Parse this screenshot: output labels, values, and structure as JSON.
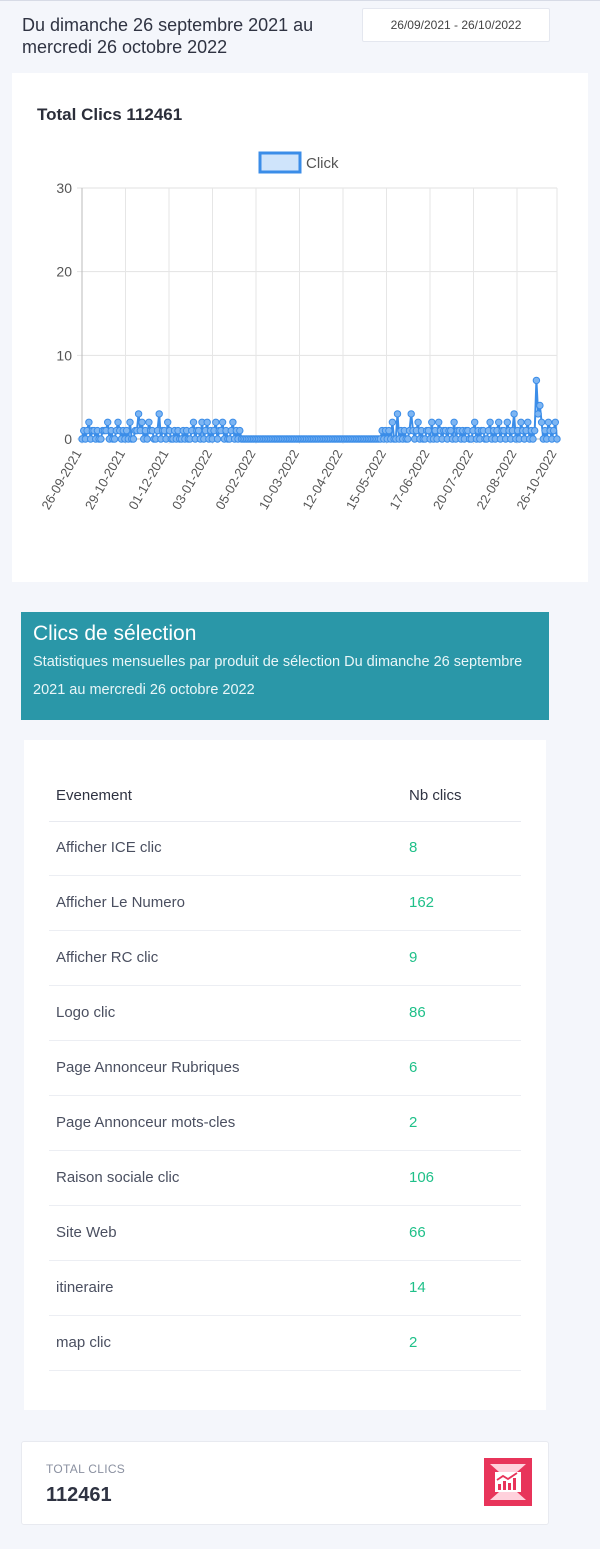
{
  "header": {
    "period_title": "Du dimanche 26 septembre 2021 au mercredi 26 octobre 2022",
    "date_range_value": "26/09/2021 - 26/10/2022"
  },
  "chart_card": {
    "title": "Total Clics 112461"
  },
  "chart_data": {
    "type": "line",
    "legend": [
      "Click"
    ],
    "legend_position": "top",
    "ylim": [
      0,
      30
    ],
    "yticks": [
      0,
      10,
      20,
      30
    ],
    "grid": true,
    "x_tick_labels": [
      "26-09-2021",
      "29-10-2021",
      "01-12-2021",
      "03-01-2022",
      "05-02-2022",
      "10-03-2022",
      "12-04-2022",
      "15-05-2022",
      "17-06-2022",
      "20-07-2022",
      "22-08-2022",
      "26-10-2022"
    ],
    "series": [
      {
        "name": "Click",
        "color": "#3b8de8",
        "values": [
          0,
          1,
          0,
          1,
          2,
          0,
          1,
          1,
          0,
          1,
          0,
          0,
          1,
          1,
          1,
          2,
          0,
          1,
          0,
          0,
          1,
          2,
          1,
          0,
          1,
          0,
          1,
          0,
          2,
          0,
          0,
          1,
          1,
          3,
          1,
          2,
          0,
          1,
          0,
          2,
          1,
          1,
          0,
          0,
          1,
          3,
          0,
          1,
          1,
          0,
          2,
          1,
          0,
          0,
          1,
          0,
          1,
          0,
          0,
          1,
          0,
          1,
          0,
          0,
          1,
          2,
          0,
          1,
          1,
          0,
          2,
          0,
          1,
          2,
          0,
          1,
          0,
          1,
          2,
          0,
          1,
          1,
          2,
          0,
          1,
          0,
          0,
          1,
          2,
          0,
          1,
          0,
          1,
          0,
          0,
          0,
          0,
          0,
          0,
          0,
          0,
          0,
          0,
          0,
          0,
          0,
          0,
          0,
          0,
          0,
          0,
          0,
          0,
          0,
          0,
          0,
          0,
          0,
          0,
          0,
          0,
          0,
          0,
          0,
          0,
          0,
          0,
          0,
          0,
          0,
          0,
          0,
          0,
          0,
          0,
          0,
          0,
          0,
          0,
          0,
          0,
          0,
          0,
          0,
          0,
          0,
          0,
          0,
          0,
          0,
          0,
          0,
          0,
          0,
          0,
          0,
          0,
          0,
          0,
          0,
          0,
          0,
          0,
          0,
          0,
          0,
          0,
          0,
          0,
          0,
          0,
          0,
          0,
          0,
          0,
          1,
          0,
          1,
          0,
          1,
          0,
          2,
          0,
          0,
          3,
          0,
          1,
          0,
          1,
          0,
          0,
          1,
          3,
          1,
          0,
          1,
          2,
          0,
          1,
          0,
          0,
          1,
          1,
          0,
          2,
          0,
          1,
          0,
          2,
          1,
          0,
          1,
          1,
          0,
          1,
          1,
          0,
          2,
          0,
          1,
          1,
          0,
          1,
          0,
          1,
          1,
          0,
          0,
          1,
          2,
          0,
          1,
          0,
          1,
          1,
          0,
          0,
          1,
          2,
          0,
          1,
          0,
          1,
          2,
          0,
          1,
          1,
          0,
          2,
          1,
          0,
          1,
          3,
          0,
          1,
          0,
          2,
          1,
          0,
          1,
          2,
          0,
          1,
          0,
          1,
          7,
          3,
          4,
          2,
          0,
          1,
          0,
          2,
          1,
          0,
          1,
          2,
          0
        ]
      }
    ]
  },
  "selection_section": {
    "title": "Clics de sélection",
    "subtitle": "Statistiques mensuelles par produit de sélection Du dimanche 26 septembre 2021 au mercredi 26 octobre 2022"
  },
  "table": {
    "columns": [
      "Evenement",
      "Nb clics"
    ],
    "rows": [
      {
        "event": "Afficher ICE clic",
        "count": "8"
      },
      {
        "event": "Afficher Le Numero",
        "count": "162"
      },
      {
        "event": "Afficher RC clic",
        "count": "9"
      },
      {
        "event": "Logo clic",
        "count": "86"
      },
      {
        "event": "Page Annonceur Rubriques",
        "count": "6"
      },
      {
        "event": "Page Annonceur mots-cles",
        "count": "2"
      },
      {
        "event": "Raison sociale clic",
        "count": "106"
      },
      {
        "event": "Site Web",
        "count": "66"
      },
      {
        "event": "itineraire",
        "count": "14"
      },
      {
        "event": "map clic",
        "count": "2"
      }
    ]
  },
  "total": {
    "label": "TOTAL CLICS",
    "value": "112461",
    "icon": "chart-trend-icon",
    "icon_color": "#e8345a"
  }
}
